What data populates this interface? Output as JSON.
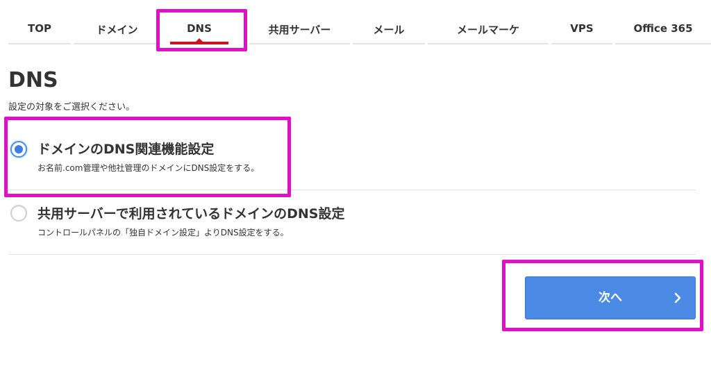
{
  "tabs": [
    {
      "label": "TOP",
      "active": false
    },
    {
      "label": "ドメイン",
      "active": false
    },
    {
      "label": "DNS",
      "active": true
    },
    {
      "label": "共用サーバー",
      "active": false
    },
    {
      "label": "メール",
      "active": false
    },
    {
      "label": "メールマーケ",
      "active": false
    },
    {
      "label": "VPS",
      "active": false
    },
    {
      "label": "Office 365",
      "active": false
    }
  ],
  "page": {
    "title": "DNS",
    "subtitle": "設定の対象をご選択ください。"
  },
  "options": [
    {
      "title": "ドメインのDNS関連機能設定",
      "description": "お名前.com管理や他社管理のドメインにDNS設定をする。",
      "selected": true
    },
    {
      "title": "共用サーバーで利用されているドメインのDNS設定",
      "description": "コントロールパネルの「独自ドメイン設定」よりDNS設定をする。",
      "selected": false
    }
  ],
  "next_button": {
    "label": "次へ",
    "icon": "chevron-right-icon"
  },
  "colors": {
    "accent_red": "#c9151e",
    "button_blue": "#4a8ae4",
    "radio_blue": "#3d7fe0",
    "highlight_magenta": "#e10fc5",
    "text": "#333333",
    "divider": "#e2e2e2"
  }
}
